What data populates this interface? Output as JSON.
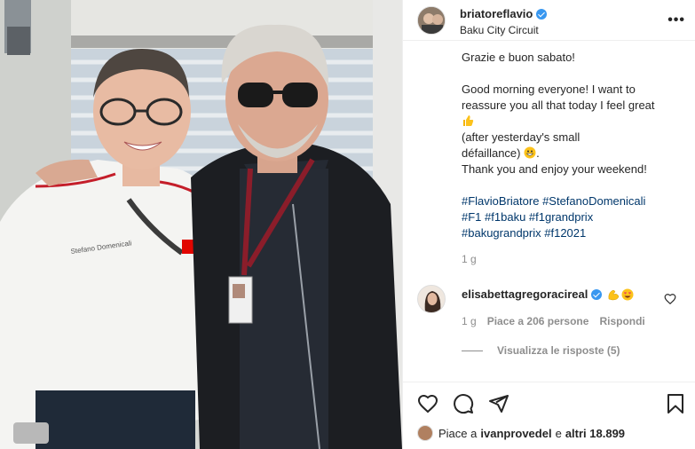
{
  "post": {
    "username": "briatoreflavio",
    "location": "Baku City Circuit",
    "more_label": "•••",
    "caption_lines": [
      "Grazie e buon sabato!",
      "",
      "Good morning everyone! I want to reassure you all that today I feel great",
      "(after yesterday's small",
      "défaillance)",
      "Thank you and enjoy your weekend!",
      "",
      "#FlavioBriatore #StefanoDomenicali",
      "#F1 #f1baku #f1grandprix",
      "#bakugrandprix #f12021"
    ],
    "caption": {
      "line1": "Grazie e buon sabato!",
      "line2": "Good morning everyone! I want to",
      "line3": "reassure you all that today I feel great",
      "line4": "(after yesterday's small",
      "line5": "défaillance)",
      "line6": "Thank you and enjoy your weekend!",
      "hashtags1": [
        "#FlavioBriatore",
        "#StefanoDomenicali"
      ],
      "hashtags2": [
        "#F1",
        "#f1baku",
        "#f1grandprix"
      ],
      "hashtags3": [
        "#bakugrandprix",
        "#f12021"
      ]
    },
    "caption_time": "1 g"
  },
  "photo": {
    "shirt_name": "Stefano Domenicali"
  },
  "comment": {
    "username": "elisabettagregoracireal",
    "time": "1 g",
    "likes_text": "Piace a 206 persone",
    "reply_label": "Rispondi",
    "view_replies": "Visualizza le risposte (5)"
  },
  "footer": {
    "likes_prefix": "Piace a",
    "likes_user": "ivanprovedel",
    "likes_middle": "e",
    "likes_others": "altri 18.899"
  },
  "colors": {
    "verified": "#3897f0",
    "hashtag": "#00376b",
    "muted": "#8e8e8e"
  },
  "icons": [
    "verified-icon",
    "more-icon",
    "heart-icon",
    "comment-icon",
    "share-icon",
    "bookmark-icon",
    "thumbs-up-emoji",
    "grinning-emoji",
    "flexed-biceps-emoji",
    "heart-eyes-emoji"
  ]
}
